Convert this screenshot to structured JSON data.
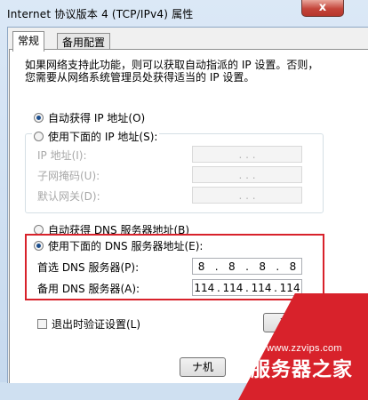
{
  "window": {
    "title": "Internet 协议版本 4 (TCP/IPv4) 属性",
    "close_label": "x"
  },
  "tabs": [
    {
      "label": "常规",
      "active": true
    },
    {
      "label": "备用配置",
      "active": false
    }
  ],
  "description": [
    "如果网络支持此功能，则可以获取自动指派的 IP 设置。否则，",
    "您需要从网络系统管理员处获得适当的 IP 设置。"
  ],
  "ip": {
    "auto_label": "自动获得 IP 地址(O)",
    "manual_label": "使用下面的 IP 地址(S):",
    "mode": "auto",
    "fields": [
      {
        "label": "IP 地址(I):",
        "value": ". . ."
      },
      {
        "label": "子网掩码(U):",
        "value": ". . ."
      },
      {
        "label": "默认网关(D):",
        "value": ". . ."
      }
    ]
  },
  "dns": {
    "auto_label": "自动获得 DNS 服务器地址(B)",
    "manual_label": "使用下面的 DNS 服务器地址(E):",
    "mode": "manual",
    "preferred_label": "首选 DNS 服务器(P):",
    "preferred_octets": [
      "8",
      "8",
      "8",
      "8"
    ],
    "alternate_label": "备用 DNS 服务器(A):",
    "alternate_octets": [
      "114",
      "114",
      "114",
      "114"
    ]
  },
  "validate_on_exit_label": "退出时验证设置(L)",
  "advanced_label": "高级",
  "ok_label": "ナ机",
  "watermark": {
    "url": "www.zzvips.com",
    "brand": "服务器之家"
  },
  "colors": {
    "highlight": "#d8222b",
    "accent": "#1c4e8d"
  }
}
